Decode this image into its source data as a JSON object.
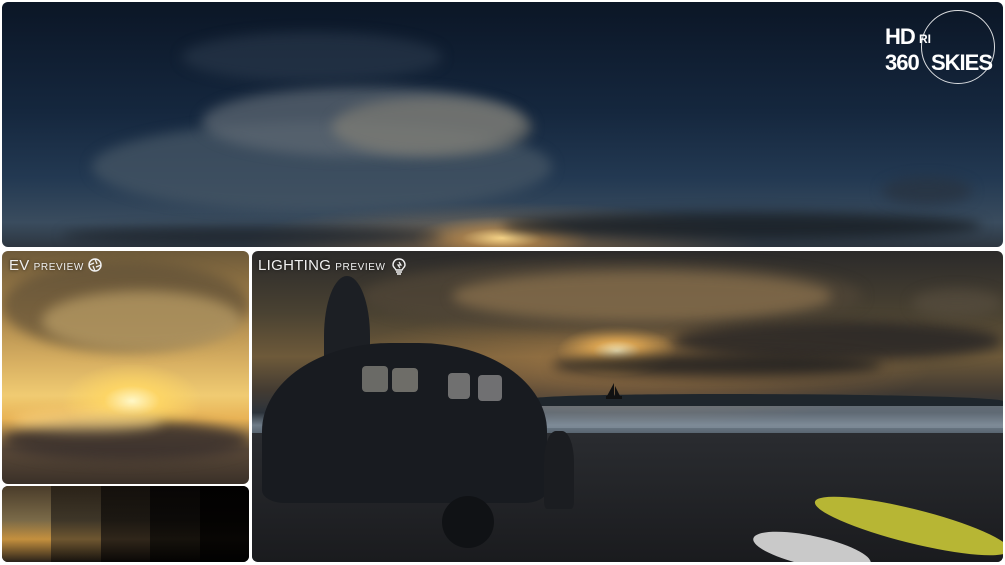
{
  "logo": {
    "line1_a": "HD",
    "line1_b": "RI",
    "line2_a": "360",
    "line2_b": "SKIES"
  },
  "ev_preview": {
    "title": "EV",
    "subtitle": "PREVIEW",
    "icon": "aperture-icon"
  },
  "lighting_preview": {
    "title": "LIGHTING",
    "subtitle": "PREVIEW",
    "icon": "lightbulb-icon"
  },
  "exposure_strip": {
    "cell_colors": [
      "#7a6a48",
      "#3e3628",
      "#1c1812",
      "#0c0a08",
      "#040302"
    ]
  },
  "colors": {
    "sky_night": "#15273e",
    "sun": "#ffe9a8",
    "silhouette": "#15181d"
  }
}
